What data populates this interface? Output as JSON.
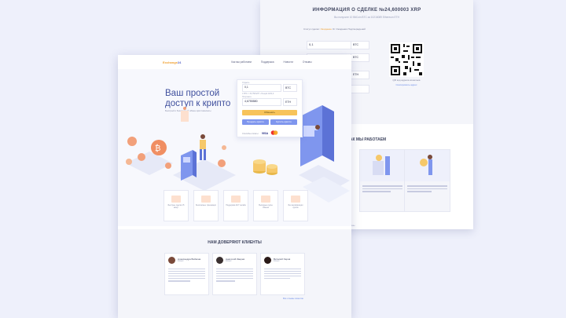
{
  "back_page": {
    "title": "ИНФОРМАЦИЯ О СДЕЛКЕ №24,600003 XRP",
    "subtitle": "Вы получите 10 BitCoin BTC за 10216089 Ethereum ETH",
    "status_label": "Статус сделки:",
    "status_value": "Ожидание",
    "status_note": "От Ожидания Подтверждений",
    "form": {
      "give_value": "0,1",
      "give_currency": "BTC",
      "get_currency": "BTC",
      "row3_currency": "ETH"
    },
    "qr_caption": "QR код адреса кошелька",
    "qr_link": "Скопировать адрес",
    "how_title": "КАК МЫ РАБОТАЕМ",
    "footer": "Exchange24 © 2024 Все права защищены"
  },
  "front_page": {
    "logo_main": "Exchange",
    "logo_accent": "24",
    "nav": [
      "Как мы работаем",
      "Поддержка",
      "Новости",
      "Отзывы"
    ],
    "hero_title_line1": "Ваш простой",
    "hero_title_line2": "доступ к крипто",
    "hero_subtitle": "Быстрый и безопасный обмен криптовалюты",
    "exchange": {
      "give_label": "Отдаёте",
      "give_value": "0,1",
      "give_currency": "BTC",
      "rate_note": "1 BTC = 33,758 ETH • Резерв 1204,0",
      "get_label": "Получаете",
      "get_value": "4,6755580",
      "get_currency": "ETH",
      "primary_button": "Обменять",
      "secondary_button_1": "Продать криптo",
      "secondary_button_2": "Купить криптo",
      "payment_label": "Способы оплаты:",
      "visa": "VISA"
    },
    "features": [
      "Быстрые сделки 15 минут",
      "Безопасные транзакции",
      "Поддержка 24/7 онлайн",
      "Выгодные курсы обмена",
      "Без верификации сделок"
    ],
    "trust_title": "НАМ ДОВЕРЯЮТ КЛИЕНТЫ",
    "reviews": [
      {
        "name": "Александра Войкина",
        "role": "Клиент"
      },
      {
        "name": "Анатолий Зверев",
        "role": "Клиент"
      },
      {
        "name": "Виталий Харов",
        "role": "Клиент"
      }
    ],
    "all_reviews": "Все отзывы клиентов"
  },
  "colors": {
    "background": "#eef0fb",
    "accent_blue": "#3f4f9d",
    "button_blue": "#7f96ee",
    "button_yellow": "#f7c35a",
    "coin_orange": "#f2a07a"
  }
}
